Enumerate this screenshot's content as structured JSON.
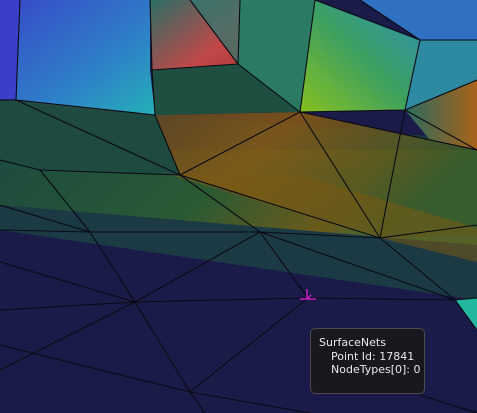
{
  "viewport": {
    "cursor_icon": "crosshair-picking-icon",
    "cursor_color": "#d020c8"
  },
  "tooltip": {
    "title": "SurfaceNets",
    "point_id_label": "Point Id:",
    "point_id_value": "17841",
    "node_types_label": "NodeTypes[0]:",
    "node_types_value": "0"
  }
}
